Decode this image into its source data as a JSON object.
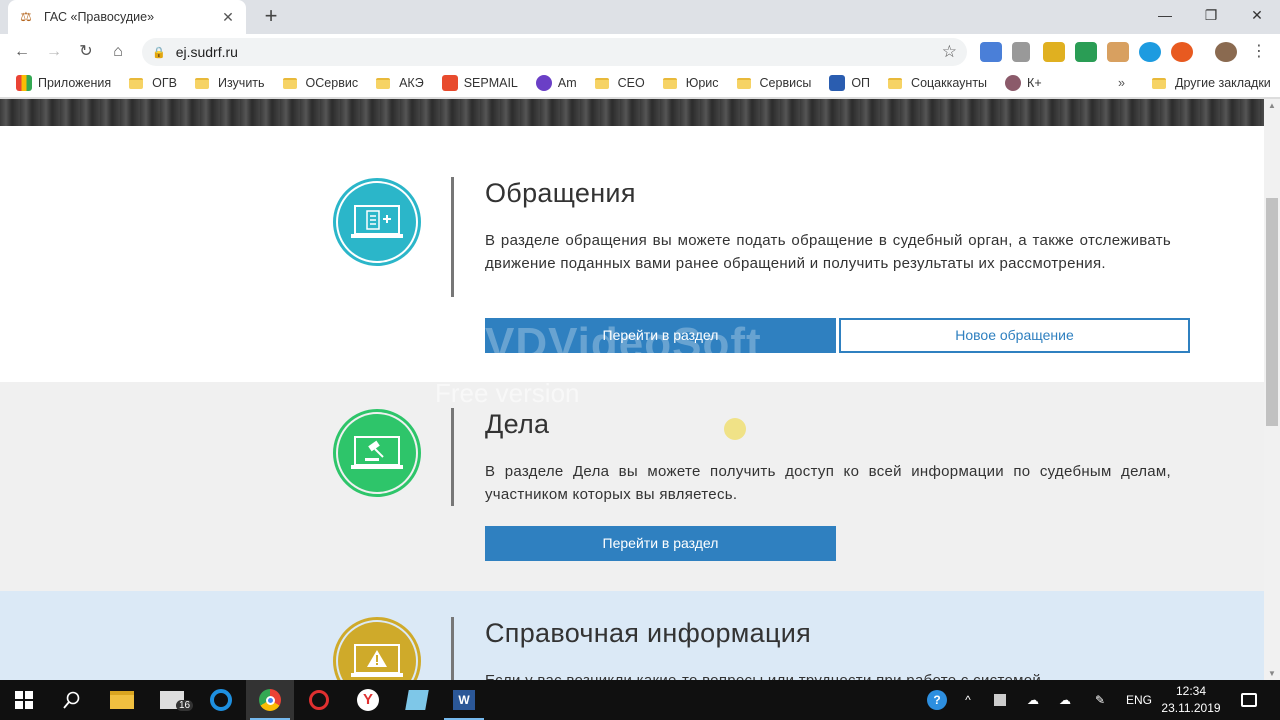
{
  "browser": {
    "tab_title": "ГАС «Правосудие»",
    "tab_close": "✕",
    "new_tab": "+",
    "url": "ej.sudrf.ru",
    "window_controls": [
      "—",
      "❐",
      "✕"
    ]
  },
  "bookmarks": {
    "items": [
      {
        "label": "Приложения",
        "icon": "apps-grid-icon"
      },
      {
        "label": "ОГВ",
        "icon": "folder-icon"
      },
      {
        "label": "Изучить",
        "icon": "folder-icon"
      },
      {
        "label": "ОСервис",
        "icon": "folder-icon"
      },
      {
        "label": "АКЭ",
        "icon": "folder-icon"
      },
      {
        "label": "SEPMAIL",
        "icon": "mail-icon"
      },
      {
        "label": "Am",
        "icon": "amocrm-icon"
      },
      {
        "label": "СЕО",
        "icon": "folder-icon"
      },
      {
        "label": "Юрис",
        "icon": "folder-icon"
      },
      {
        "label": "Сервисы",
        "icon": "folder-icon"
      },
      {
        "label": "ОП",
        "icon": "emblem-icon"
      },
      {
        "label": "Соцаккаунты",
        "icon": "folder-icon"
      },
      {
        "label": "К+",
        "icon": "consultant-icon"
      }
    ],
    "more": "»",
    "other": "Другие закладки"
  },
  "sections": [
    {
      "title": "Обращения",
      "description": "В разделе обращения вы можете подать обращение в судебный орган, а также отслеживать движение поданных вами ранее обращений и получить результаты их рассмотрения.",
      "primary_button": "Перейти в раздел",
      "secondary_button": "Новое обращение",
      "icon": "document-add-icon",
      "color": "#2bb6c9"
    },
    {
      "title": "Дела",
      "description": "В разделе Дела вы можете получить доступ ко всей информации по судебным делам, участником которых вы являетесь.",
      "primary_button": "Перейти в раздел",
      "icon": "gavel-icon",
      "color": "#2ec56a"
    },
    {
      "title": "Справочная информация",
      "description": "Если у вас возникли какие-то вопросы или трудности при работе с системой",
      "icon": "info-icon",
      "color": "#cfaa2a"
    }
  ],
  "watermark": {
    "main": "VDVideoSoft",
    "sub": "Free version"
  },
  "taskbar": {
    "badge": "16",
    "lang": "ENG",
    "time": "12:34",
    "date": "23.11.2019"
  }
}
